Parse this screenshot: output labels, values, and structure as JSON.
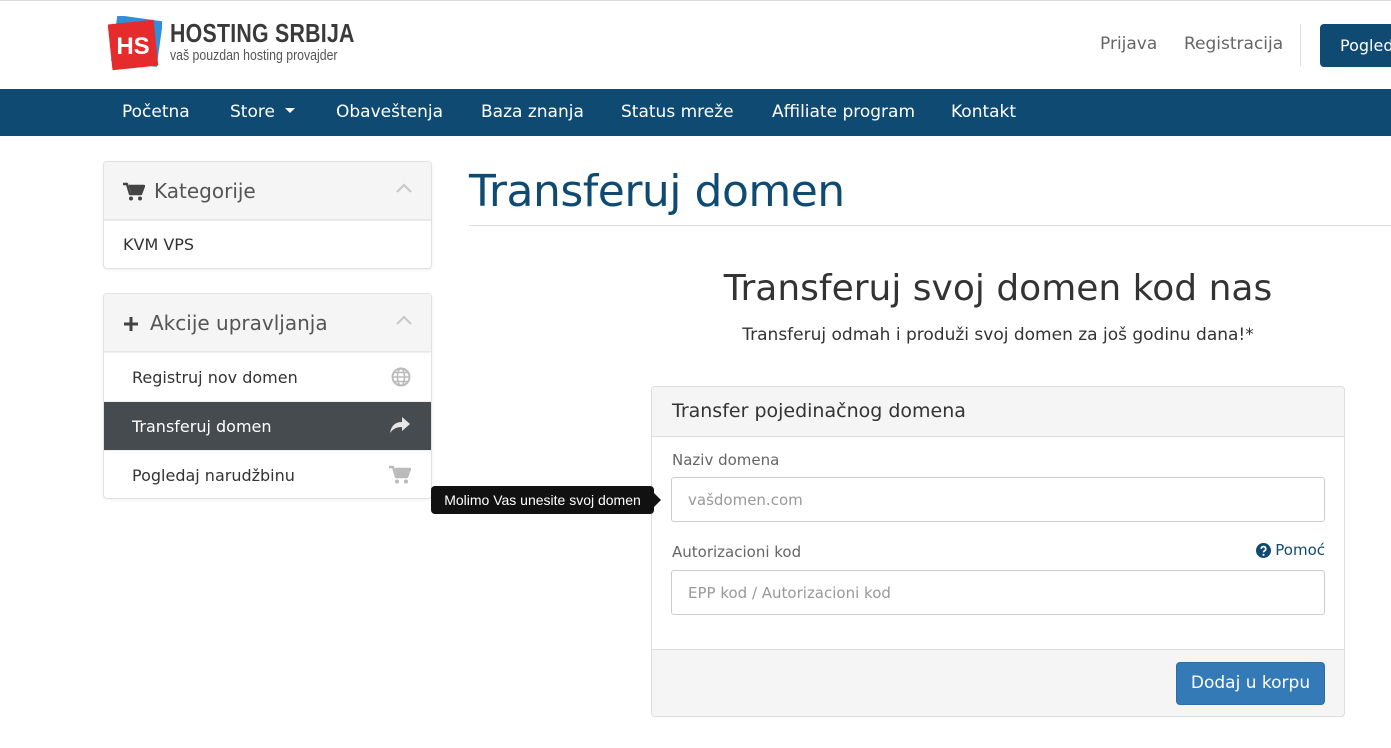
{
  "header": {
    "logo_badge": "HS",
    "logo_title": "HOSTING SRBIJA",
    "logo_subtitle": "vaš pouzdan hosting provajder",
    "login_label": "Prijava",
    "register_label": "Registracija",
    "view_cart_label": "Pogled"
  },
  "nav": {
    "items": [
      {
        "label": "Početna"
      },
      {
        "label": "Store"
      },
      {
        "label": "Obaveštenja"
      },
      {
        "label": "Baza znanja"
      },
      {
        "label": "Status mreže"
      },
      {
        "label": "Affiliate program"
      },
      {
        "label": "Kontakt"
      }
    ]
  },
  "sidebar": {
    "categories": {
      "title": "Kategorije",
      "icon": "cart-icon",
      "items": [
        {
          "label": "KVM VPS"
        }
      ]
    },
    "actions": {
      "title": "Akcije upravljanja",
      "icon": "plus-icon",
      "items": [
        {
          "label": "Registruj nov domen",
          "icon": "globe-icon"
        },
        {
          "label": "Transferuj domen",
          "icon": "share-arrow-icon",
          "active": true
        },
        {
          "label": "Pogledaj narudžbinu",
          "icon": "cart-icon"
        }
      ]
    }
  },
  "main": {
    "page_title": "Transferuj domen",
    "hero_title": "Transferuj svoj domen kod nas",
    "hero_subtitle": "Transferuj odmah i produži svoj domen za još godinu dana!*",
    "card": {
      "title": "Transfer pojedinačnog domena",
      "domain_label": "Naziv domena",
      "domain_placeholder": "vašdomen.com",
      "auth_label": "Autorizacioni kod",
      "auth_placeholder": "EPP kod / Autorizacioni kod",
      "help_label": "Pomoć",
      "add_button": "Dodaj u korpu"
    },
    "tooltip": "Molimo Vas unesite svoj domen"
  },
  "colors": {
    "brand": "#0e4a72",
    "button": "#337ab7",
    "active_sidebar": "#464b50",
    "logo_red": "#e52b2b"
  }
}
